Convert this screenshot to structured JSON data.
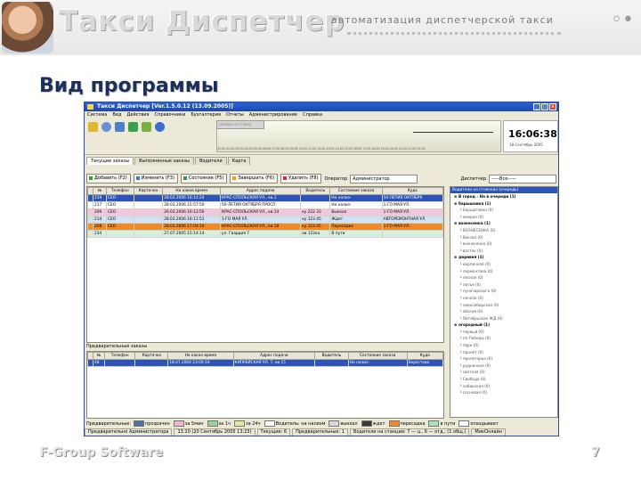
{
  "slide": {
    "logo_title": "Такси Диспетчер",
    "tagline": "автоматизация диспетчерской такси",
    "section_title": "Вид программы",
    "footer_brand": "F-Group Software",
    "page_number": "7"
  },
  "app": {
    "title": "Такси Диспетчер [Ver.1.5.0.12 (13.09.2005)]",
    "window_buttons": [
      "_",
      "□",
      "×"
    ],
    "menu": [
      "Система",
      "Вид",
      "Действия",
      "Справочники",
      "Бухгалтерия",
      "Отчеты",
      "Администрирование",
      "Справка"
    ],
    "display_field": "Нажми на ставку",
    "graph_labels": "01:00 02:00 03:00 04:00 05:00 06:00 07:00 08:00 09:00 10:00 11:00 12:00 13:00 14:00 15:00 16:00 17:00 18:00 19:00 20:00 21:00 22:00 23:00",
    "clock_time": "16:06:38",
    "clock_date": "18 Сентябрь 2005",
    "tabs": [
      "Текущие заказы",
      "Выполненные заказы",
      "Водители",
      "Карта"
    ],
    "actions": [
      {
        "label": "Добавить (F2)",
        "color": "#3a9a3a"
      },
      {
        "label": "Изменить (F3)",
        "color": "#3a78d0"
      },
      {
        "label": "Состояние (F5)",
        "color": "#3a9a3a"
      },
      {
        "label": "Завершить (F6)",
        "color": "#e0a020"
      },
      {
        "label": "Удалить (F8)",
        "color": "#d03030"
      }
    ],
    "operator_label": "Оператор",
    "operator_value": "Администратор",
    "dispatcher_label": "Диспетчер",
    "dispatcher_value": "-----Все-----",
    "columns": [
      "№",
      "Телефон",
      "Карточка",
      "На какое время",
      "Адрес подачи",
      "Водитель",
      "Состояние заказа",
      "Куда"
    ],
    "rows": [
      {
        "id": "219",
        "phone": "СЕО",
        "card": "",
        "time": "28.03.2006 16:14:24",
        "address": "КРАС-СПОЛЬСКАЯ УЛ., кв.1",
        "driver": "",
        "status": "На нализ-",
        "dest": "50-ЛЕТИЯ ОКТЯБРЯ",
        "color": "#ffffff",
        "selected": true
      },
      {
        "id": "217",
        "phone": "СЕО",
        "card": "",
        "time": "28.03.2006 15:57:50",
        "address": "50-ЛЕТИЯ ОКТЯБРЯ ПРОСП.",
        "driver": "",
        "status": "На нализ-",
        "dest": "1-ГО МАЯ УЛ.",
        "color": "#ffffff",
        "selected": false
      },
      {
        "id": "209",
        "phone": "СЕО",
        "card": "",
        "time": "26.03.2006 16:13:56",
        "address": "КРАС-СПОЛЬСКАЯ УЛ., кв.14",
        "driver": "ку 222 33",
        "status": "Выехал",
        "dest": "1-ГО МАЯ УЛ.",
        "color": "#f2c6dc",
        "selected": false
      },
      {
        "id": "214",
        "phone": "СЕО",
        "card": "",
        "time": "28.03.2006 16:11:51",
        "address": "1-ГО МАЯ УЛ.",
        "driver": "ку 123 45",
        "status": "Ждет",
        "dest": "АВТОРЕМОНТНАЯ УЛ.",
        "color": "#cfe2f6",
        "selected": false
      },
      {
        "id": "208",
        "phone": "СЕО",
        "card": "",
        "time": "28.03.2006 17:04:10",
        "address": "КРАС-СПОЛЬСКАЯ УЛ., кв.18",
        "driver": "ку 123 45",
        "status": "Пересадка",
        "dest": "1-ГО МАЯ УЛ.",
        "color": "#f08a28",
        "selected": false
      },
      {
        "id": "234",
        "phone": "",
        "card": "",
        "time": "27.07.2005 15:14:14",
        "address": "ул. Гвардия 7",
        "driver": "ав 123ха",
        "status": "В пути",
        "dest": "",
        "color": "#d6efe0",
        "selected": false
      }
    ],
    "side_header": "Водители на стоянках (очередь)",
    "side_items": [
      {
        "label": "В город - На в очереди (1)",
        "kind": "group"
      },
      {
        "label": "барышовка (1)",
        "kind": "group"
      },
      {
        "label": "Борщаговка (0)",
        "kind": "sub"
      },
      {
        "label": "мокрое (0)",
        "kind": "sub"
      },
      {
        "label": "вознесенка (1)",
        "kind": "group"
      },
      {
        "label": "ВОЗНЕСЕНКА (0)",
        "kind": "sub"
      },
      {
        "label": "Вокзал (0)",
        "kind": "sub"
      },
      {
        "label": "вознесенка (0)",
        "kind": "sub"
      },
      {
        "label": "восток (0)",
        "kind": "sub"
      },
      {
        "label": "деревня (1)",
        "kind": "group"
      },
      {
        "label": "кирпичная (0)",
        "kind": "sub"
      },
      {
        "label": "лермонтова (0)",
        "kind": "sub"
      },
      {
        "label": "лесная (0)",
        "kind": "sub"
      },
      {
        "label": "литья (0)",
        "kind": "sub"
      },
      {
        "label": "луначарского (0)",
        "kind": "sub"
      },
      {
        "label": "начало (0)",
        "kind": "sub"
      },
      {
        "label": "новосибирская (0)",
        "kind": "sub"
      },
      {
        "label": "обская (0)",
        "kind": "sub"
      },
      {
        "label": "Октябрьская ЖД (0)",
        "kind": "sub"
      },
      {
        "label": "огородный (1)",
        "kind": "group"
      },
      {
        "label": "первый (0)",
        "kind": "sub"
      },
      {
        "label": "пл.Победы (0)",
        "kind": "sub"
      },
      {
        "label": "парк (0)",
        "kind": "sub"
      },
      {
        "label": "пролёт (0)",
        "kind": "sub"
      },
      {
        "label": "пролетарка (0)",
        "kind": "sub"
      },
      {
        "label": "рудничная (0)",
        "kind": "sub"
      },
      {
        "label": "светлая (0)",
        "kind": "sub"
      },
      {
        "label": "Свобода (0)",
        "kind": "sub"
      },
      {
        "label": "сибирская (0)",
        "kind": "sub"
      },
      {
        "label": "сосновая (0)",
        "kind": "sub"
      }
    ],
    "prelim_label": "Предварительные заказы",
    "prelim_columns": [
      "№",
      "Телефон",
      "Карточка",
      "На какое время",
      "Адрес подачи",
      "Водитель",
      "Состояние заказа",
      "Куда"
    ],
    "prelim_rows": [
      {
        "id": "48",
        "phone": "",
        "card": "",
        "time": "18.07.2004 23:00:16",
        "address": "КИПРЕЙСКАЯ УЛ. 7, кв.15",
        "driver": "",
        "status": "На нализ-",
        "dest": "Берестова"
      }
    ],
    "legend_label": "Предварительные:",
    "legend": [
      {
        "label": "прозрачен",
        "color": "#4f6fa8"
      },
      {
        "label": "за 5мин",
        "color": "#f2b6c8"
      },
      {
        "label": "за 1ч",
        "color": "#9ad29a"
      },
      {
        "label": "за 24ч",
        "color": "#e6e6a0"
      },
      {
        "label": "Водитель: на нализм",
        "color": "#ffffff"
      },
      {
        "label": "выехал",
        "color": "#d8d8d8"
      },
      {
        "label": "ждет",
        "color": "#3a3a3a"
      },
      {
        "label": "пересадка",
        "color": "#f08a28"
      },
      {
        "label": "в пути",
        "color": "#a8e0c0"
      },
      {
        "label": "опаздывает",
        "color": "#ffffff"
      }
    ],
    "status": [
      "Предварительно Администратора",
      "13.20 (20 Сентябрь 2005 13:23)",
      "Текущие: 6",
      "Предварительные: 1",
      "Водители на станции: 7 — ц., 6 — отд., (1 общ.)",
      "МикОнлайн"
    ]
  }
}
